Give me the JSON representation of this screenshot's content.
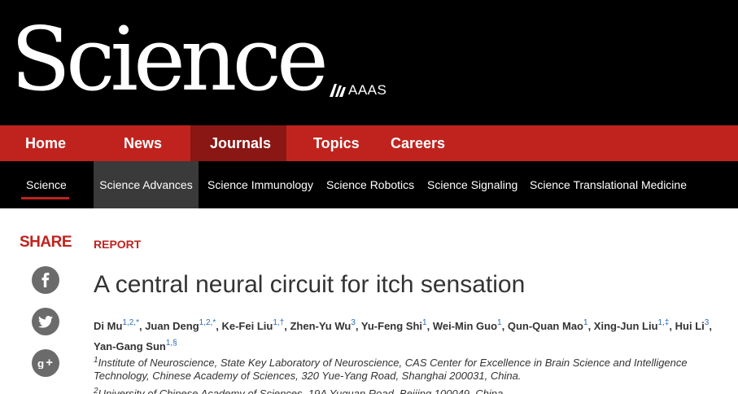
{
  "brand": {
    "logo_text": "Science",
    "aaas_text": "AAAS"
  },
  "primary_nav": [
    {
      "label": "Home",
      "active": false
    },
    {
      "label": "News",
      "active": false
    },
    {
      "label": "Journals",
      "active": true
    },
    {
      "label": "Topics",
      "active": false
    },
    {
      "label": "Careers",
      "active": false
    }
  ],
  "secondary_nav": [
    {
      "label": "Science",
      "selected": true
    },
    {
      "label": "Science Advances",
      "hovered": true
    },
    {
      "label": "Science Immunology"
    },
    {
      "label": "Science Robotics"
    },
    {
      "label": "Science Signaling"
    },
    {
      "label": "Science Translational Medicine"
    }
  ],
  "share": {
    "label": "SHARE",
    "icons": [
      "facebook-icon",
      "twitter-icon",
      "google-plus-icon"
    ]
  },
  "article": {
    "kicker": "REPORT",
    "title": "A central neural circuit for itch sensation",
    "authors": [
      {
        "name": "Di Mu",
        "sup": "1,2,*"
      },
      {
        "name": "Juan Deng",
        "sup": "1,2,*"
      },
      {
        "name": "Ke-Fei Liu",
        "sup": "1,†"
      },
      {
        "name": "Zhen-Yu Wu",
        "sup": "3"
      },
      {
        "name": "Yu-Feng Shi",
        "sup": "1"
      },
      {
        "name": "Wei-Min Guo",
        "sup": "1"
      },
      {
        "name": "Qun-Quan Mao",
        "sup": "1"
      },
      {
        "name": "Xing-Jun Liu",
        "sup": "1,‡"
      },
      {
        "name": "Hui Li",
        "sup": "3"
      },
      {
        "name": "Yan-Gang Sun",
        "sup": "1,§"
      }
    ],
    "affiliations": [
      {
        "num": "1",
        "text": "Institute of Neuroscience, State Key Laboratory of Neuroscience, CAS Center for Excellence in Brain Science and Intelligence Technology, Chinese Academy of Sciences, 320 Yue-Yang Road, Shanghai 200031, China."
      },
      {
        "num": "2",
        "text": "University of Chinese Academy of Sciences, 19A Yuquan Road, Beijing 100049, China."
      }
    ]
  },
  "colors": {
    "brand_red": "#c0231e",
    "active_red": "#8a1714",
    "black": "#000000",
    "link_blue": "#2a6ab8"
  }
}
